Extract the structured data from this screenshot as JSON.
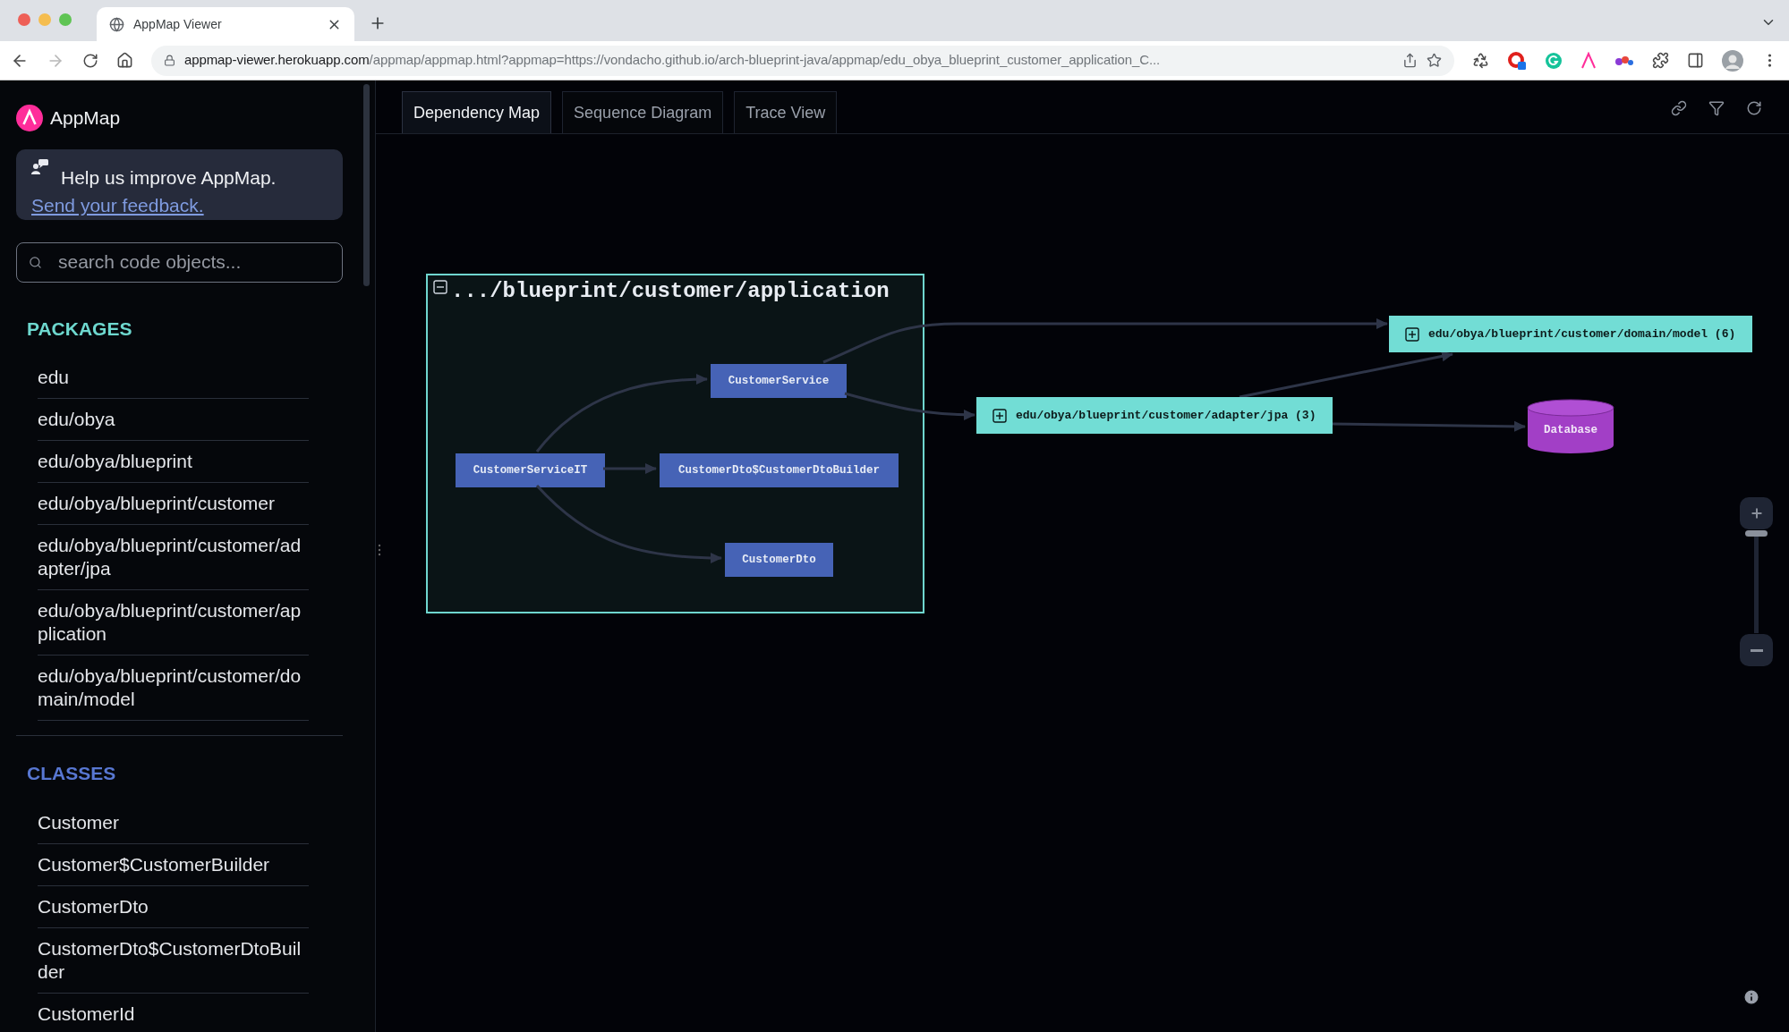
{
  "browser": {
    "tab_title": "AppMap Viewer",
    "url_host": "appmap-viewer.herokuapp.com",
    "url_path": "/appmap/appmap.html?appmap=https://vondacho.github.io/arch-blueprint-java/appmap/edu_obya_blueprint_customer_application_C..."
  },
  "sidebar": {
    "brand": "AppMap",
    "feedback": {
      "text": "Help us improve AppMap.",
      "link": "Send your feedback."
    },
    "search": {
      "placeholder": "search code objects..."
    },
    "packages": {
      "heading": "PACKAGES",
      "items": [
        "edu",
        "edu/obya",
        "edu/obya/blueprint",
        "edu/obya/blueprint/customer",
        "edu/obya/blueprint/customer/adapter/jpa",
        "edu/obya/blueprint/customer/application",
        "edu/obya/blueprint/customer/domain/model"
      ]
    },
    "classes": {
      "heading": "CLASSES",
      "items": [
        "Customer",
        "Customer$CustomerBuilder",
        "CustomerDto",
        "CustomerDto$CustomerDtoBuilder",
        "CustomerId"
      ]
    }
  },
  "tabs": [
    {
      "label": "Dependency Map",
      "selected": true
    },
    {
      "label": "Sequence Diagram",
      "selected": false
    },
    {
      "label": "Trace View",
      "selected": false
    }
  ],
  "diagram": {
    "nodes": [
      {
        "kind": "package",
        "label": ".../blueprint/customer/application",
        "expanded": true,
        "children": [
          {
            "kind": "class",
            "label": "CustomerService"
          },
          {
            "kind": "class",
            "label": "CustomerServiceIT"
          },
          {
            "kind": "class",
            "label": "CustomerDto$CustomerDtoBuilder"
          },
          {
            "kind": "class",
            "label": "CustomerDto"
          }
        ]
      },
      {
        "kind": "package",
        "label": "edu/obya/blueprint/customer/domain/model (6)",
        "expanded": false
      },
      {
        "kind": "package",
        "label": "edu/obya/blueprint/customer/adapter/jpa (3)",
        "expanded": false
      },
      {
        "kind": "database",
        "label": "Database"
      }
    ]
  },
  "zoom_slider": {
    "level": 1
  }
}
